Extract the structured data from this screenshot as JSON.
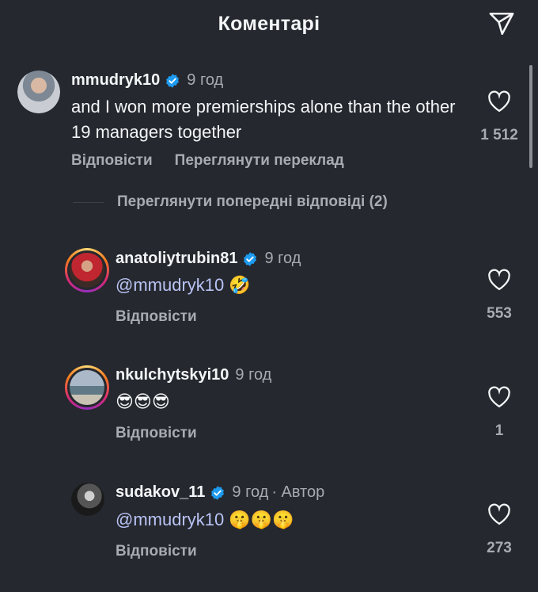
{
  "header": {
    "title": "Коментарі",
    "share_icon": "paper-plane-icon"
  },
  "colors": {
    "background": "#25282e",
    "mention": "#b9c3f5",
    "verified": "#1d9bf0",
    "muted": "#a8abb1"
  },
  "main_comment": {
    "username": "mmudryk10",
    "verified": true,
    "time": "9 год",
    "text": "and I won more premierships alone than the other 19 managers together",
    "likes": "1 512",
    "reply_label": "Відповісти",
    "translate_label": "Переглянути переклад"
  },
  "view_previous_replies": "Переглянути попередні відповіді (2)",
  "replies": [
    {
      "username": "anatoliytrubin81",
      "verified": true,
      "time": "9 год",
      "mention": "@mmudryk10",
      "emoji": "🤣",
      "likes": "553",
      "reply_label": "Відповісти"
    },
    {
      "username": "nkulchytskyi10",
      "verified": false,
      "time": "9 год",
      "emoji": "😎😎😎",
      "likes": "1",
      "reply_label": "Відповісти"
    },
    {
      "username": "sudakov_11",
      "verified": true,
      "time": "9 год",
      "author_tag": "· Автор",
      "mention": "@mmudryk10",
      "emoji": "🤫🤫🤫",
      "likes": "273",
      "reply_label": "Відповісти"
    }
  ]
}
